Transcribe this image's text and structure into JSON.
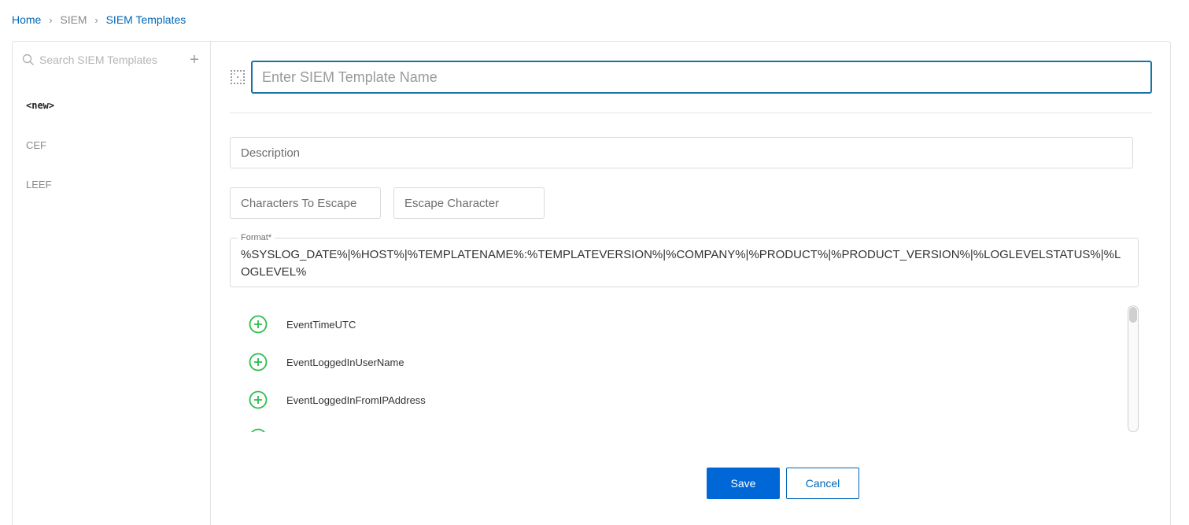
{
  "breadcrumb": {
    "home": "Home",
    "siem": "SIEM",
    "current": "SIEM Templates",
    "separator": "›"
  },
  "sidebar": {
    "search_placeholder": "Search SIEM Templates",
    "add_symbol": "+",
    "items": [
      {
        "label": "<new>",
        "active": true
      },
      {
        "label": "CEF",
        "active": false
      },
      {
        "label": "LEEF",
        "active": false
      }
    ]
  },
  "editor": {
    "name_placeholder": "Enter SIEM Template Name",
    "description_placeholder": "Description",
    "chars_to_escape_placeholder": "Characters To Escape",
    "escape_char_placeholder": "Escape Character",
    "format_label": "Format*",
    "format_value": "%SYSLOG_DATE%|%HOST%|%TEMPLATENAME%:%TEMPLATEVERSION%|%COMPANY%|%PRODUCT%|%PRODUCT_VERSION%|%LOGLEVELSTATUS%|%LOGLEVEL%",
    "fields": [
      "EventTimeUTC",
      "EventLoggedInUserName",
      "EventLoggedInFromIPAddress",
      ""
    ]
  },
  "actions": {
    "save_label": "Save",
    "cancel_label": "Cancel"
  },
  "colors": {
    "accent": "#0067d6",
    "link": "#0067b8",
    "add_field_icon": "#2ebd4e",
    "focused_border": "#1a73a8"
  }
}
